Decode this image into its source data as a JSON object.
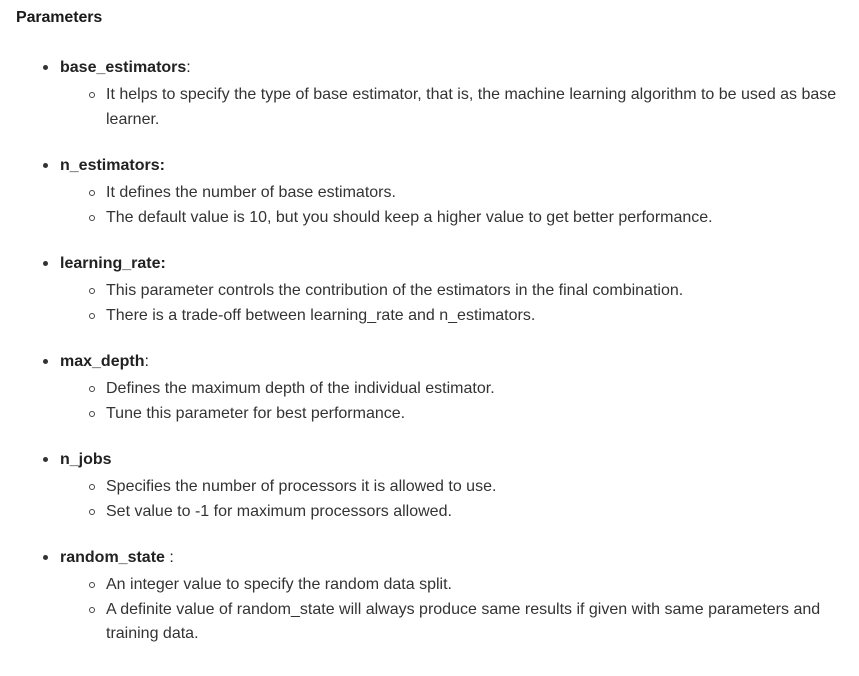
{
  "heading": "Parameters",
  "params": [
    {
      "name": "base_estimators",
      "suffix": ":",
      "descriptions": [
        "It helps to specify the type of base estimator, that is, the machine learning algorithm to be used as base learner."
      ]
    },
    {
      "name": "n_estimators:",
      "suffix": "",
      "descriptions": [
        "It defines the number of base estimators.",
        "The default value is 10, but you should keep a higher value to get better performance."
      ]
    },
    {
      "name": "learning_rate:",
      "suffix": "",
      "descriptions": [
        "This parameter controls the contribution of the estimators in the final combination.",
        "There is a trade-off between learning_rate and n_estimators."
      ]
    },
    {
      "name": "max_depth",
      "suffix": ":",
      "descriptions": [
        "Defines the maximum depth of the individual estimator.",
        "Tune this parameter for best performance."
      ]
    },
    {
      "name": "n_jobs",
      "suffix": "",
      "descriptions": [
        "Specifies the number of processors it is allowed to use.",
        "Set value to -1 for maximum processors allowed."
      ]
    },
    {
      "name": "random_state",
      "suffix": " :",
      "descriptions": [
        "An integer value to specify the random data split.",
        "A definite value of random_state will always produce same results if given with same parameters and training data."
      ]
    }
  ]
}
